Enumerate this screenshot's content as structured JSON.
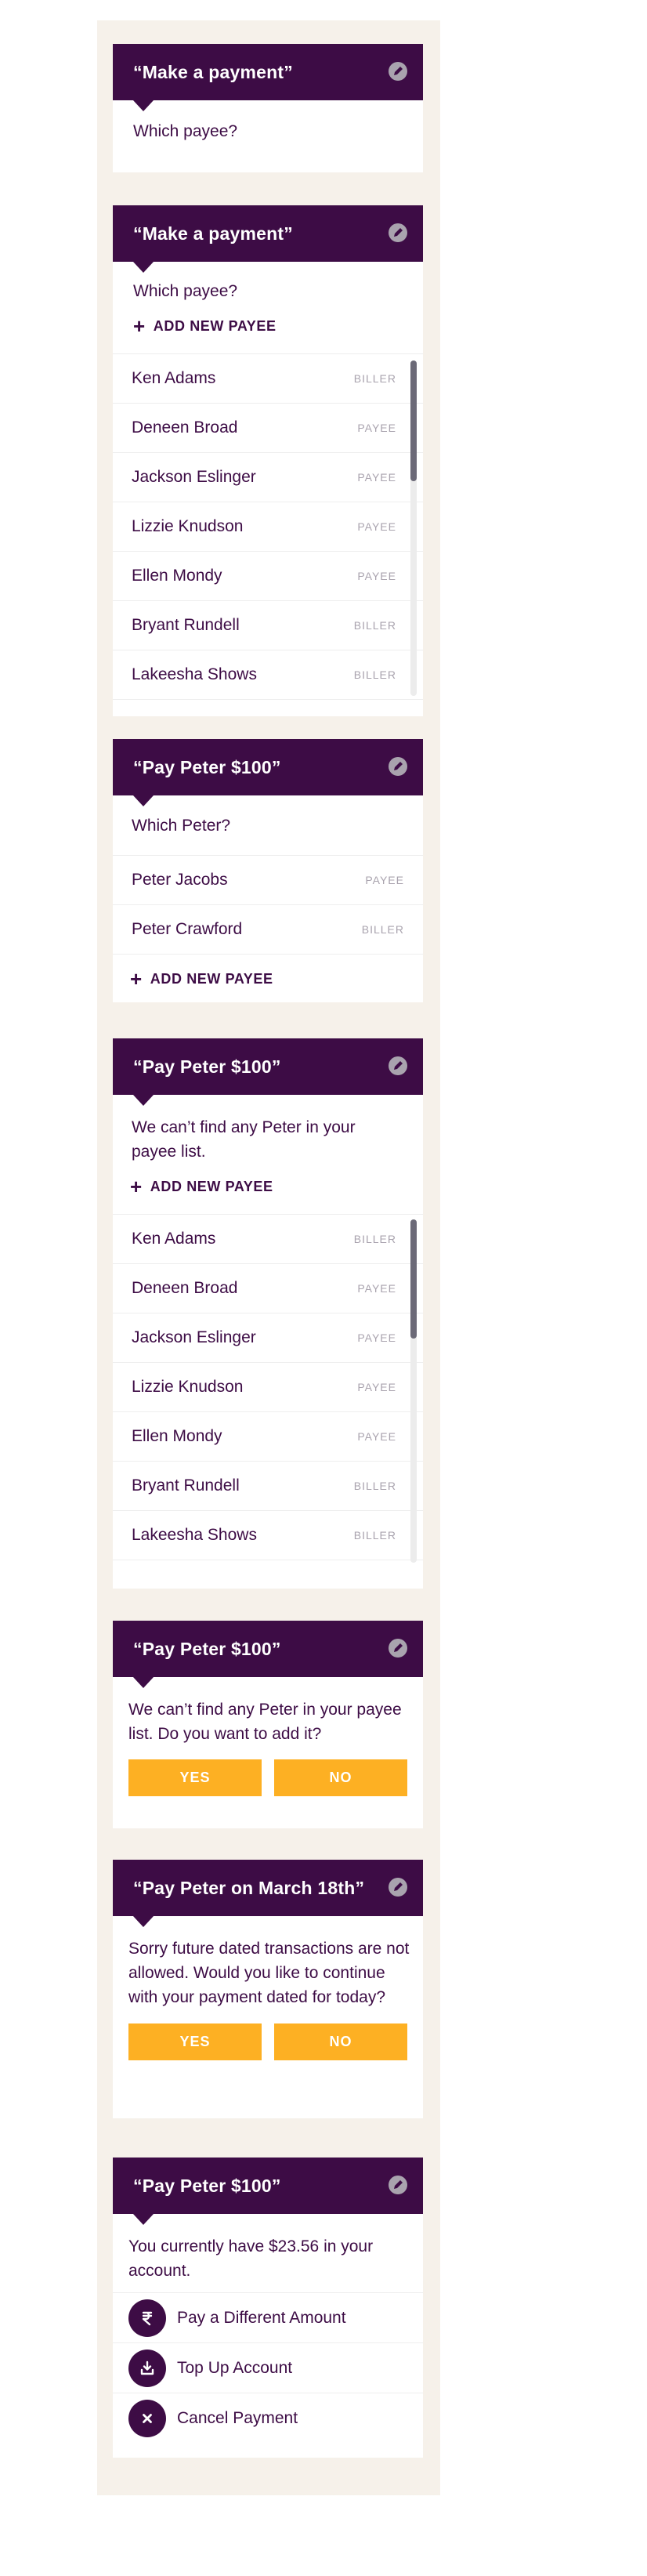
{
  "colors": {
    "brand": "#3d0c45",
    "accent": "#fdb023",
    "muted": "#a9a3ae",
    "panel": "#f6f1ea"
  },
  "card1": {
    "title": "“Make a payment”",
    "prompt": "Which payee?"
  },
  "card2": {
    "title": "“Make a payment”",
    "prompt": "Which payee?",
    "add_label": "ADD NEW PAYEE",
    "rows": [
      {
        "name": "Ken Adams",
        "tag": "BILLER"
      },
      {
        "name": "Deneen Broad",
        "tag": "PAYEE"
      },
      {
        "name": "Jackson Eslinger",
        "tag": "PAYEE"
      },
      {
        "name": "Lizzie Knudson",
        "tag": "PAYEE"
      },
      {
        "name": "Ellen Mondy",
        "tag": "PAYEE"
      },
      {
        "name": "Bryant Rundell",
        "tag": "BILLER"
      },
      {
        "name": "Lakeesha Shows",
        "tag": "BILLER"
      }
    ]
  },
  "card3": {
    "title": "“Pay Peter $100”",
    "prompt": "Which Peter?",
    "rows": [
      {
        "name": "Peter Jacobs",
        "tag": "PAYEE"
      },
      {
        "name": "Peter Crawford",
        "tag": "BILLER"
      }
    ],
    "add_label": "ADD NEW PAYEE"
  },
  "card4": {
    "title": "“Pay Peter $100”",
    "prompt": "We can’t find any Peter in your payee list.",
    "add_label": "ADD NEW PAYEE",
    "rows": [
      {
        "name": "Ken Adams",
        "tag": "BILLER"
      },
      {
        "name": "Deneen Broad",
        "tag": "PAYEE"
      },
      {
        "name": "Jackson Eslinger",
        "tag": "PAYEE"
      },
      {
        "name": "Lizzie Knudson",
        "tag": "PAYEE"
      },
      {
        "name": "Ellen Mondy",
        "tag": "PAYEE"
      },
      {
        "name": "Bryant Rundell",
        "tag": "BILLER"
      },
      {
        "name": "Lakeesha Shows",
        "tag": "BILLER"
      }
    ]
  },
  "card5": {
    "title": "“Pay Peter $100”",
    "prompt": "We can’t find any Peter in your payee list. Do you want to add it?",
    "yes_label": "YES",
    "no_label": "NO"
  },
  "card6": {
    "title": "“Pay Peter on March 18th”",
    "prompt": "Sorry future dated transactions are not allowed. Would you like to continue with your payment dated for today?",
    "yes_label": "YES",
    "no_label": "NO"
  },
  "card7": {
    "title": "“Pay Peter $100”",
    "prompt": "You currently have $23.56 in your account.",
    "options": [
      {
        "icon": "rupee-icon",
        "label": "Pay a Different Amount"
      },
      {
        "icon": "download-icon",
        "label": "Top Up Account"
      },
      {
        "icon": "close-icon",
        "label": "Cancel Payment"
      }
    ]
  }
}
